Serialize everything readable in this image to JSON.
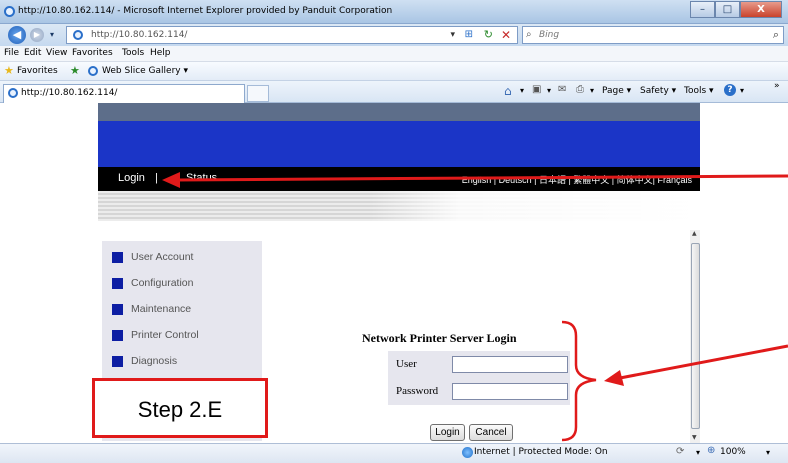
{
  "window": {
    "title": "http://10.80.162.114/ - Microsoft Internet Explorer provided by Panduit Corporation",
    "minimize": "–",
    "maximize": "□",
    "close": "X"
  },
  "address": {
    "url": "http://10.80.162.114/",
    "search_placeholder": "Bing"
  },
  "menu": [
    "File",
    "Edit",
    "View",
    "Favorites",
    "Tools",
    "Help"
  ],
  "favorites": {
    "label": "Favorites",
    "gallery": "Web Slice Gallery ▾"
  },
  "tab": {
    "label": "http://10.80.162.114/"
  },
  "commandbar": {
    "page": "Page ▾",
    "safety": "Safety ▾",
    "tools": "Tools ▾"
  },
  "page": {
    "nav": {
      "login": "Login",
      "separator": "|",
      "status": "Status"
    },
    "languages": "English | Deutsch | 日本語 | 繁體中文 | 简体中文| Français",
    "sidebar": [
      "User Account",
      "Configuration",
      "Maintenance",
      "Printer Control",
      "Diagnosis"
    ],
    "login_form": {
      "title": "Network Printer Server Login",
      "user_label": "User",
      "password_label": "Password",
      "user_value": "",
      "password_value": "",
      "login_button": "Login",
      "cancel_button": "Cancel"
    }
  },
  "status": {
    "zone": "Internet | Protected Mode: On",
    "zoom": "100%"
  },
  "annotation": {
    "step": "Step 2.E",
    "color": "#e01a1a"
  },
  "colors": {
    "header_blue": "#1b35c7",
    "sidebar_square": "#0d1ea3",
    "sidebar_bg": "#e6e6ee"
  }
}
